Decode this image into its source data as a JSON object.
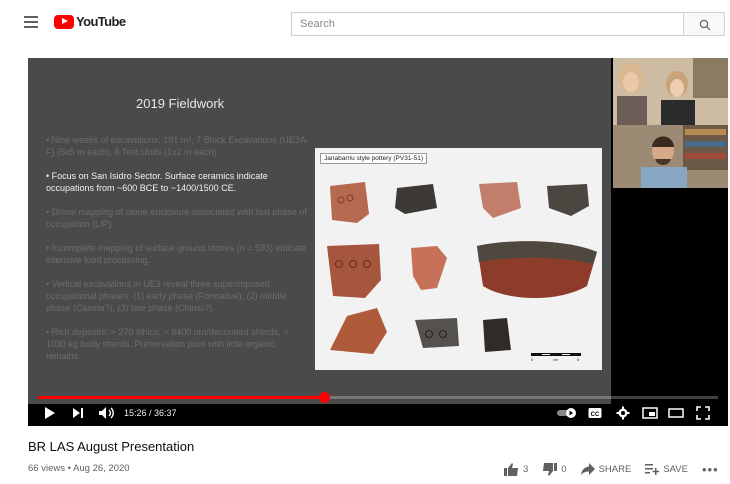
{
  "header": {
    "logo_text": "YouTube",
    "search_placeholder": "Search"
  },
  "slide": {
    "title": "2019 Fieldwork",
    "bullets": [
      "• Nine weeks of excavations, 191 m², 7 Block Excavations (UE3A-F) (5x5 m each), 8 Test Units (1x2 m each).",
      "• Focus on San Isidro Sector. Surface ceramics indicate occupations from ~600 BCE to ~1400/1500 CE.",
      "• Drone mapping of stone enclosure associated with last phase of occupation (LIP).",
      "• Incomplete mapping of surface ground stones (n = 593) indicate intensive food processing.",
      "• Vertical excavations in UE3 reveal three superimposed occupational phases: (1) early phase (Formative), (2) middle phase (Casma?), (3) late phase (Chimú?).",
      "• Rich deposits: > 270 lithics, > 8400 nm/decorated sherds, > 1030 kg body sherds. Preservation poor with little organic remains."
    ],
    "pottery_caption": "Janabarriu style pottery (PV31-51)",
    "scale_zero": "0",
    "scale_five": "5",
    "scale_unit": "cm"
  },
  "player": {
    "time_display": "15:26 / 36:37",
    "progress": 0.42
  },
  "video": {
    "title": "BR LAS August Presentation",
    "meta": "66 views • Aug 26, 2020",
    "likes": "3",
    "dislikes": "0",
    "share_label": "SHARE",
    "save_label": "SAVE",
    "more_label": "•••"
  },
  "colors": {
    "brand_red": "#ff0000",
    "slide_bg": "#4a4a4a"
  }
}
